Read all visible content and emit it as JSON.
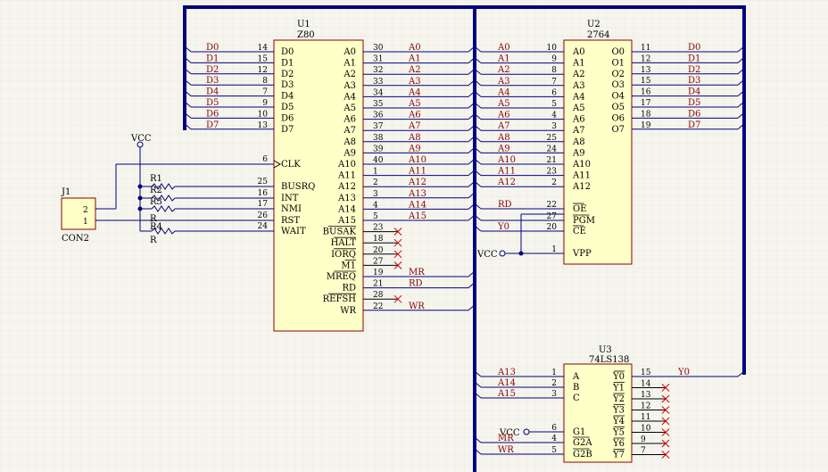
{
  "colors": {
    "wire": "#000080",
    "body": "#ffffc8",
    "body_border": "#8b0000",
    "net_label": "#8b0000",
    "grid": "#dcdcd0",
    "no_connect": "#d00000"
  },
  "u1": {
    "ref": "U1",
    "part": "Z80",
    "left_pins": [
      [
        "D0",
        "14"
      ],
      [
        "D1",
        "15"
      ],
      [
        "D2",
        "12"
      ],
      [
        "D3",
        "8"
      ],
      [
        "D4",
        "7"
      ],
      [
        "D5",
        "9"
      ],
      [
        "D6",
        "10"
      ],
      [
        "D7",
        "13"
      ]
    ],
    "left_ctrl": [
      [
        "CLK",
        "6"
      ],
      [
        "BUSRQ",
        "25"
      ],
      [
        "INT",
        "16"
      ],
      [
        "NMI",
        "17"
      ],
      [
        "RST",
        "26"
      ],
      [
        "WAIT",
        "24"
      ]
    ],
    "right_pins": [
      [
        "A0",
        "30"
      ],
      [
        "A1",
        "31"
      ],
      [
        "A2",
        "32"
      ],
      [
        "A3",
        "33"
      ],
      [
        "A4",
        "34"
      ],
      [
        "A5",
        "35"
      ],
      [
        "A6",
        "36"
      ],
      [
        "A7",
        "37"
      ],
      [
        "A8",
        "38"
      ],
      [
        "A9",
        "39"
      ],
      [
        "A10",
        "40"
      ],
      [
        "A11",
        "1"
      ],
      [
        "A12",
        "2"
      ],
      [
        "A13",
        "3"
      ],
      [
        "A14",
        "4"
      ],
      [
        "A15",
        "5"
      ],
      [
        "BUSAK",
        "23"
      ],
      [
        "HALT",
        "18"
      ],
      [
        "IORQ",
        "20"
      ],
      [
        "M1",
        "27"
      ],
      [
        "MREQ",
        "19"
      ],
      [
        "RD",
        "21"
      ],
      [
        "REFSH",
        "28"
      ],
      [
        "WR",
        "22"
      ]
    ],
    "right_nets": [
      "A0",
      "A1",
      "A2",
      "A3",
      "A4",
      "A5",
      "A6",
      "A7",
      "A8",
      "A9",
      "A10",
      "A11",
      "A12",
      "A13",
      "A14",
      "A15",
      "",
      "",
      "",
      "",
      "MR",
      "RD",
      "",
      "WR"
    ],
    "left_nets": [
      "D0",
      "D1",
      "D2",
      "D3",
      "D4",
      "D5",
      "D6",
      "D7"
    ]
  },
  "u2": {
    "ref": "U2",
    "part": "2764",
    "left_pins": [
      [
        "A0",
        "10"
      ],
      [
        "A1",
        "9"
      ],
      [
        "A2",
        "8"
      ],
      [
        "A3",
        "7"
      ],
      [
        "A4",
        "6"
      ],
      [
        "A5",
        "5"
      ],
      [
        "A6",
        "4"
      ],
      [
        "A7",
        "3"
      ],
      [
        "A8",
        "25"
      ],
      [
        "A9",
        "24"
      ],
      [
        "A10",
        "21"
      ],
      [
        "A11",
        "23"
      ],
      [
        "A12",
        "2"
      ],
      [
        "OE",
        "22"
      ],
      [
        "PGM",
        "27"
      ],
      [
        "CE",
        "20"
      ],
      [
        "VPP",
        "1"
      ]
    ],
    "left_nets": [
      "A0",
      "A1",
      "A2",
      "A3",
      "A4",
      "A5",
      "A6",
      "A7",
      "A8",
      "A9",
      "A10",
      "A11",
      "A12",
      "RD",
      "",
      "Y0",
      ""
    ],
    "right_pins": [
      [
        "O0",
        "11"
      ],
      [
        "O1",
        "12"
      ],
      [
        "O2",
        "13"
      ],
      [
        "O3",
        "15"
      ],
      [
        "O4",
        "16"
      ],
      [
        "O5",
        "17"
      ],
      [
        "O6",
        "18"
      ],
      [
        "O7",
        "19"
      ]
    ],
    "right_nets": [
      "D0",
      "D1",
      "D2",
      "D3",
      "D4",
      "D5",
      "D6",
      "D7"
    ]
  },
  "u3": {
    "ref": "U3",
    "part": "74LS138",
    "left_pins": [
      [
        "A",
        "1"
      ],
      [
        "B",
        "2"
      ],
      [
        "C",
        "3"
      ],
      [
        "G1",
        "6"
      ],
      [
        "G2A",
        "4"
      ],
      [
        "G2B",
        "5"
      ]
    ],
    "left_nets": [
      "A13",
      "A14",
      "A15",
      "VCC",
      "MR",
      "WR"
    ],
    "right_pins": [
      [
        "Y0",
        "15"
      ],
      [
        "Y1",
        "14"
      ],
      [
        "Y2",
        "13"
      ],
      [
        "Y3",
        "12"
      ],
      [
        "Y4",
        "11"
      ],
      [
        "Y5",
        "10"
      ],
      [
        "Y6",
        "9"
      ],
      [
        "Y7",
        "7"
      ]
    ],
    "right_nets": [
      "Y0",
      "",
      "",
      "",
      "",
      "",
      "",
      ""
    ]
  },
  "j1": {
    "ref": "J1",
    "part": "CON2",
    "pins": [
      "2",
      "1"
    ]
  },
  "resistors": [
    {
      "ref": "R1"
    },
    {
      "ref": "R2"
    },
    {
      "ref": "R3"
    },
    {
      "ref": "R4"
    }
  ],
  "resistor_value": "R",
  "power": {
    "vcc": "VCC"
  }
}
